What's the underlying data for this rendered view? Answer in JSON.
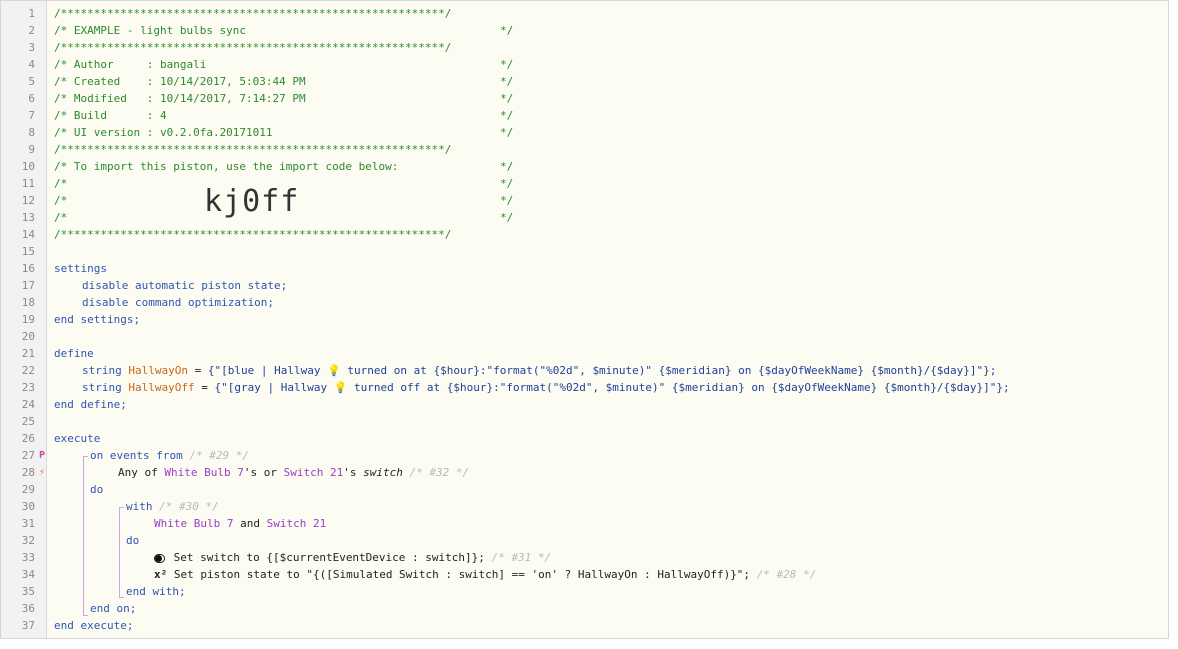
{
  "code": {
    "header": {
      "rule": "/**********************************************************/",
      "line2_open": "/* EXAMPLE - light bulbs sync",
      "line2_close": "*/",
      "author": "/* Author     : bangali",
      "author_close": "*/",
      "created": "/* Created    : 10/14/2017, 5:03:44 PM",
      "created_close": "*/",
      "modified": "/* Modified   : 10/14/2017, 7:14:27 PM",
      "modified_close": "*/",
      "build": "/* Build      : 4",
      "build_close": "*/",
      "ui_version": "/* UI version : v0.2.0fa.20171011",
      "ui_version_close": "*/",
      "import_text": "/* To import this piston, use the import code below:",
      "import_text_close": "*/",
      "blank_open": "/*",
      "blank_close": "*/",
      "import_code": "kj0ff"
    },
    "settings": {
      "open": "settings",
      "line1": "disable automatic piston state;",
      "line2": "disable command optimization;",
      "close": "end settings;"
    },
    "define": {
      "open": "define",
      "kw_string": "string",
      "var_on": "HallwayOn",
      "eq": "=",
      "val_on_a": "{\"[blue | Hallway ",
      "bulb": "💡",
      "val_on_b": " turned on at {$hour}:\"format(\"%02d\", $minute)\" {$meridian} on {$dayOfWeekName} {$month}/{$day}]\"};",
      "var_off": "HallwayOff",
      "val_off_a": "{\"[gray | Hallway ",
      "val_off_b": " turned off at {$hour}:\"format(\"%02d\", $minute)\" {$meridian} on {$dayOfWeekName} {$month}/{$day}]\"};",
      "close": "end define;"
    },
    "execute": {
      "open": "execute",
      "on_events_from": "on events from",
      "id29": "/* #29 */",
      "any_of": "Any of",
      "dev_white_bulb": "White Bulb 7",
      "apos_s_or": "'s or",
      "dev_switch": "Switch 21",
      "apos_s": "'s",
      "attr_switch": "switch",
      "id32": "/* #32 */",
      "do": "do",
      "with": "with",
      "id30": "/* #30 */",
      "and": "and",
      "set_switch_a": "Set switch to",
      "set_switch_b": "{[$currentEventDevice : switch]};",
      "id31": "/* #31 */",
      "x2": "x²",
      "set_state_a": "Set piston state to",
      "set_state_b": "\"{([Simulated Switch : switch] == 'on' ? HallwayOn : HallwayOff)}\";",
      "id28": "/* #28 */",
      "end_with": "end with;",
      "end_on": "end on;",
      "close": "end execute;"
    }
  },
  "gutter": {
    "line_numbers": [
      "1",
      "2",
      "3",
      "4",
      "5",
      "6",
      "7",
      "8",
      "9",
      "10",
      "11",
      "12",
      "13",
      "14",
      "15",
      "16",
      "17",
      "18",
      "19",
      "20",
      "21",
      "22",
      "23",
      "24",
      "25",
      "26",
      "27",
      "28",
      "29",
      "30",
      "31",
      "32",
      "33",
      "34",
      "35",
      "36",
      "37"
    ],
    "marker_27": "P",
    "marker_28": "⚡"
  },
  "colors": {
    "comment": "#2d8a2d",
    "keyword": "#2f55b5",
    "variable": "#c8681e",
    "device": "#9a3dc9",
    "marker_p": "#d147a3",
    "marker_bolt": "#e8782a"
  }
}
